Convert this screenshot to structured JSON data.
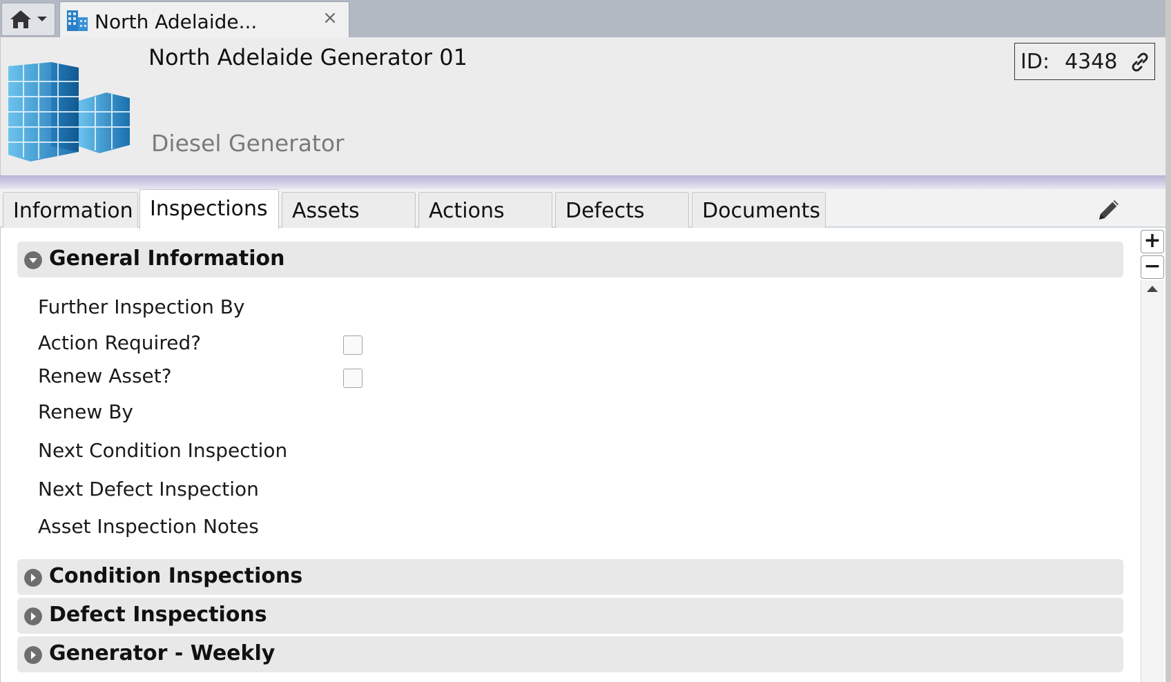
{
  "tabstrip": {
    "doc_tab_title": "North Adelaide...",
    "close_glyph": "×"
  },
  "header": {
    "title": "North Adelaide Generator 01",
    "subtitle": "Diesel Generator",
    "id_label": "ID:",
    "id_value": "4348"
  },
  "tabs": [
    {
      "label": "Information"
    },
    {
      "label": "Inspections",
      "active": true
    },
    {
      "label": "Assets"
    },
    {
      "label": "Actions"
    },
    {
      "label": "Defects"
    },
    {
      "label": "Documents"
    }
  ],
  "sections": {
    "general": {
      "title": "General Information",
      "expanded": true,
      "fields": [
        {
          "label": "Further Inspection By"
        },
        {
          "label": "Action Required?",
          "checkbox": true,
          "checked": false
        },
        {
          "label": "Renew Asset?",
          "checkbox": true,
          "checked": false
        },
        {
          "label": "Renew By"
        },
        {
          "label": "Next Condition Inspection"
        },
        {
          "label": "Next Defect Inspection"
        },
        {
          "label": "Asset Inspection Notes"
        }
      ]
    },
    "condition": {
      "title": "Condition Inspections",
      "expanded": false
    },
    "defect": {
      "title": "Defect Inspections",
      "expanded": false
    },
    "generator": {
      "title": "Generator - Weekly",
      "expanded": false
    }
  },
  "controls": {
    "zoom_in": "+",
    "zoom_out": "−"
  },
  "icons": {
    "home": "home-icon",
    "building": "building-icon",
    "link": "link-icon",
    "edit": "pencil-icon"
  },
  "colors": {
    "header_bg": "#ececec",
    "tabstrip_bg": "#b3b9c2",
    "section_bg": "#e8e8e8",
    "accent_band": "#b9b3d6"
  }
}
